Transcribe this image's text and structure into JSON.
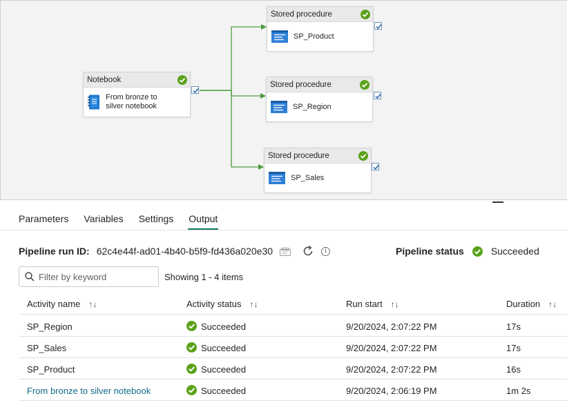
{
  "pipeline": {
    "nodes": {
      "notebook": {
        "type": "Notebook",
        "name_line1": "From bronze to",
        "name_line2": "silver notebook",
        "status": "succeeded"
      },
      "sp_product": {
        "type": "Stored procedure",
        "name": "SP_Product",
        "status": "succeeded"
      },
      "sp_region": {
        "type": "Stored procedure",
        "name": "SP_Region",
        "status": "succeeded"
      },
      "sp_sales": {
        "type": "Stored procedure",
        "name": "SP_Sales",
        "status": "succeeded"
      }
    }
  },
  "tabs": [
    {
      "label": "Parameters"
    },
    {
      "label": "Variables"
    },
    {
      "label": "Settings"
    },
    {
      "label": "Output",
      "active": true
    }
  ],
  "run": {
    "id_label": "Pipeline run ID:",
    "id_value": "62c4e44f-ad01-4b40-b5f9-fd436a020e30",
    "status_label": "Pipeline status",
    "status_value": "Succeeded"
  },
  "filter": {
    "placeholder": "Filter by keyword",
    "showing": "Showing 1 - 4 items"
  },
  "table": {
    "columns": [
      "Activity name",
      "Activity status",
      "Run start",
      "Duration"
    ],
    "rows": [
      {
        "name": "SP_Region",
        "status": "Succeeded",
        "start": "9/20/2024, 2:07:22 PM",
        "duration": "17s"
      },
      {
        "name": "SP_Sales",
        "status": "Succeeded",
        "start": "9/20/2024, 2:07:22 PM",
        "duration": "17s"
      },
      {
        "name": "SP_Product",
        "status": "Succeeded",
        "start": "9/20/2024, 2:07:22 PM",
        "duration": "16s"
      },
      {
        "name": "From bronze to silver notebook",
        "status": "Succeeded",
        "start": "9/20/2024, 2:06:19 PM",
        "duration": "1m 2s"
      }
    ]
  },
  "colors": {
    "success": "#5aa21a",
    "edge": "#4c9a3c",
    "accent": "#117865",
    "link": "#0f6a86"
  },
  "icons": {
    "success": "check-circle-icon",
    "notebook": "notebook-icon",
    "stored_procedure": "stored-procedure-icon",
    "copy": "copy-icon",
    "refresh": "refresh-icon",
    "info": "info-icon",
    "search": "search-icon",
    "sort": "sort-arrows-icon"
  }
}
